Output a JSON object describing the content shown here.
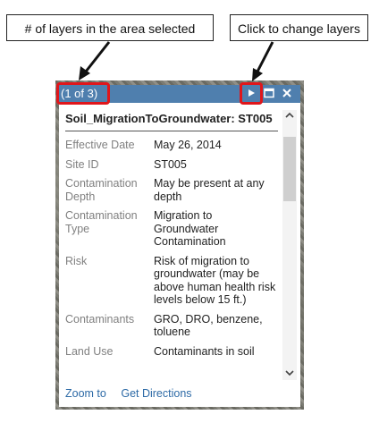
{
  "callouts": {
    "layers_count": "# of layers in the area selected",
    "change_layers": "Click to change layers"
  },
  "popup": {
    "counter": "(1 of 3)",
    "title": "Soil_MigrationToGroundwater: ST005",
    "attributes": [
      {
        "label": "Effective Date",
        "value": "May 26, 2014"
      },
      {
        "label": "Site ID",
        "value": "ST005"
      },
      {
        "label": "Contamination Depth",
        "value": "May be present at any depth"
      },
      {
        "label": "Contamination Type",
        "value": "Migration to Groundwater Contamination"
      },
      {
        "label": "Risk",
        "value": "Risk of migration to groundwater (may be above human health risk levels below 15 ft.)"
      },
      {
        "label": "Contaminants",
        "value": "GRO, DRO, benzene, toluene"
      },
      {
        "label": "Land Use",
        "value": "Contaminants in soil"
      }
    ],
    "footer": {
      "zoom_to": "Zoom to",
      "get_directions": "Get Directions"
    }
  },
  "icons": {
    "next": "play-triangle-icon",
    "maximize": "maximize-icon",
    "close": "close-icon",
    "scroll_up": "chevron-up-icon",
    "scroll_down": "chevron-down-icon"
  },
  "colors": {
    "titlebar": "#4f7fae",
    "highlight": "#e0161b",
    "link": "#2d6aa6"
  }
}
